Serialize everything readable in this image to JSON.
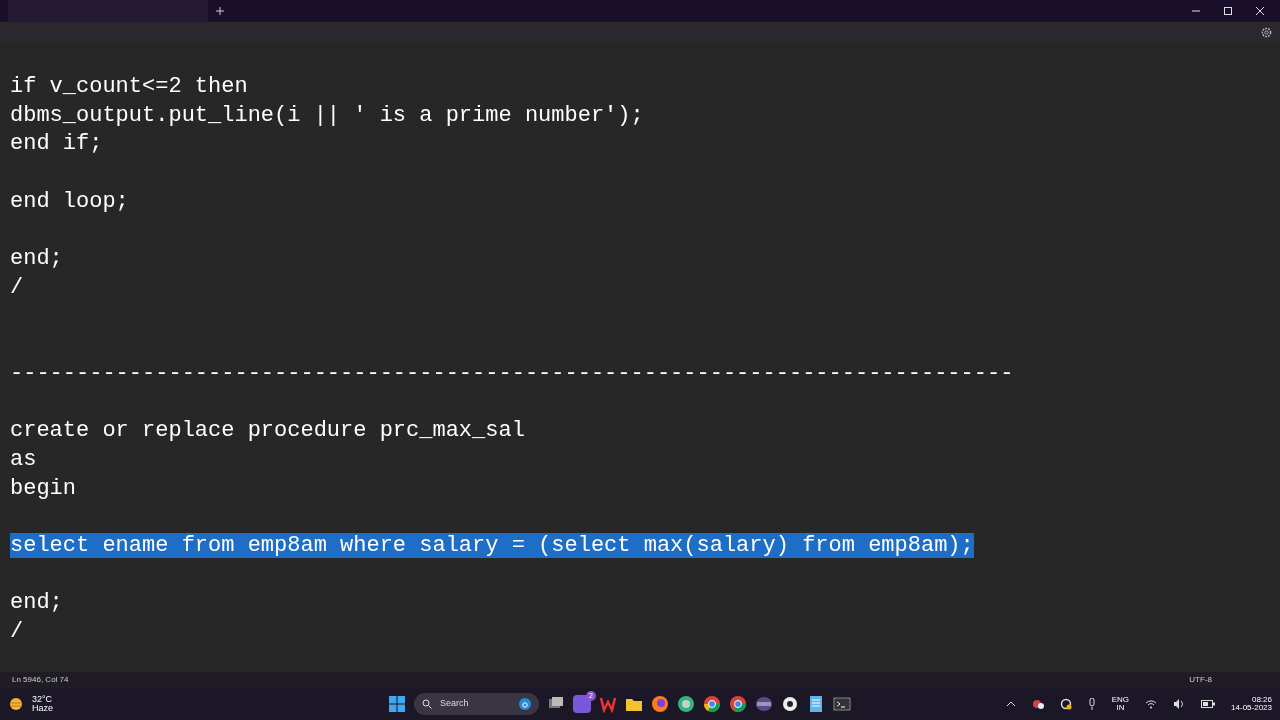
{
  "editor": {
    "lines": [
      {
        "kind": "code",
        "text": "if v_count<=2 then",
        "selected": false
      },
      {
        "kind": "code",
        "text": "dbms_output.put_line(i || ' is a prime number');",
        "selected": false
      },
      {
        "kind": "code",
        "text": "end if;",
        "selected": false
      },
      {
        "kind": "blank"
      },
      {
        "kind": "code",
        "text": "end loop;",
        "selected": false
      },
      {
        "kind": "blank"
      },
      {
        "kind": "code",
        "text": "end;",
        "selected": false
      },
      {
        "kind": "code",
        "text": "/",
        "selected": false
      },
      {
        "kind": "blank"
      },
      {
        "kind": "blank"
      },
      {
        "kind": "code",
        "text": "----------------------------------------------------------------------------",
        "selected": false
      },
      {
        "kind": "blank"
      },
      {
        "kind": "code",
        "text": "create or replace procedure prc_max_sal",
        "selected": false
      },
      {
        "kind": "code",
        "text": "as",
        "selected": false
      },
      {
        "kind": "code",
        "text": "begin",
        "selected": false
      },
      {
        "kind": "blank"
      },
      {
        "kind": "code",
        "text": "select ename from emp8am where salary = (select max(salary) from emp8am);",
        "selected": true
      },
      {
        "kind": "blank"
      },
      {
        "kind": "code",
        "text": "end;",
        "selected": false
      },
      {
        "kind": "code",
        "text": "/",
        "selected": false
      }
    ]
  },
  "status_bar": {
    "position": "Ln 5946, Col 74",
    "encoding": "UTF-8"
  },
  "taskbar": {
    "weather": {
      "temperature": "32°C",
      "condition": "Haze"
    },
    "search": {
      "placeholder": "Search"
    },
    "chat_badge": "2",
    "tray": {
      "language": "ENG",
      "region": "IN",
      "time": "08:26",
      "date": "14-05-2023"
    }
  }
}
